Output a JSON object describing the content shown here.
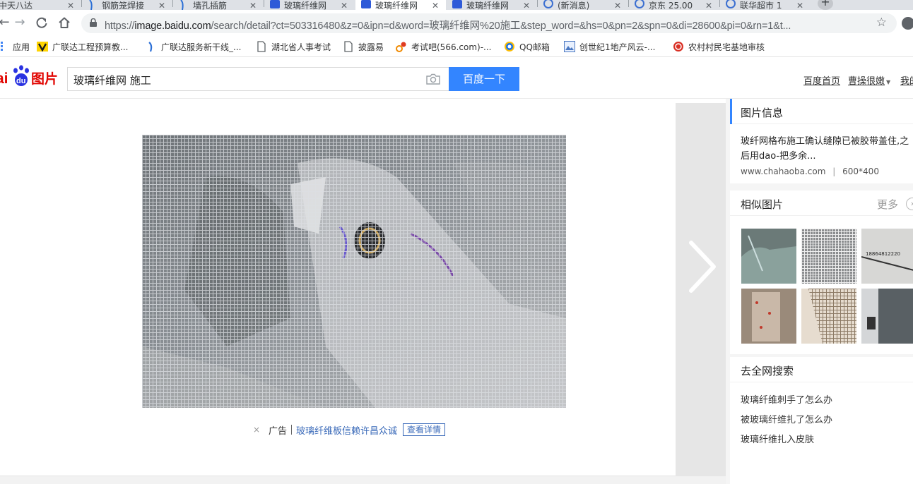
{
  "browser": {
    "tabs": [
      {
        "title": "中天八达",
        "favicon": "web-icon"
      },
      {
        "title": "钢筋笼焊接",
        "favicon": "paw-icon"
      },
      {
        "title": "墙孔插筋",
        "favicon": "paw-icon"
      },
      {
        "title": "玻璃纤维网",
        "favicon": "baidu-du-icon"
      },
      {
        "title": "玻璃纤维网",
        "favicon": "baidu-du-icon",
        "active": true
      },
      {
        "title": "玻璃纤维网",
        "favicon": "baidu-du-icon"
      },
      {
        "title": "(新消息)",
        "favicon": "globe-icon"
      },
      {
        "title": "京东 25.00",
        "favicon": "globe-icon"
      },
      {
        "title": "联华超市 1",
        "favicon": "globe-icon"
      }
    ],
    "new_tab": "+",
    "url": {
      "host_prefix": "https://",
      "host": "image.baidu.com",
      "path": "/search/detail?ct=503316480&z=0&ipn=d&word=玻璃纤维网%20施工&step_word=&hs=0&pn=2&spn=0&di=28600&pi=0&rn=1&t..."
    },
    "bookmarks": [
      {
        "label": "应用",
        "icon": "apps-grid-icon"
      },
      {
        "label": "广联达工程预算教...",
        "icon": "bookmark-favicon-icon"
      },
      {
        "label": "广联达服务新干线_...",
        "icon": "paw-icon"
      },
      {
        "label": "湖北省人事考试",
        "icon": "page-icon"
      },
      {
        "label": "披露易",
        "icon": "page-icon"
      },
      {
        "label": "考试吧(566.com)-...",
        "icon": "kaoshi-icon"
      },
      {
        "label": "QQ邮箱",
        "icon": "qq-mail-icon"
      },
      {
        "label": "创世纪1地产风云-...",
        "icon": "image-favicon-icon"
      },
      {
        "label": "农村村民宅基地审核",
        "icon": "red-seal-icon"
      }
    ]
  },
  "baidu": {
    "logo_text": "Baidu",
    "logo_cn": "图片",
    "search_query": "玻璃纤维网 施工",
    "search_button": "百度一下",
    "top_links": [
      "百度首页",
      "曹操很嫩",
      "我的"
    ],
    "main_image_alt": "玻璃纤维网格布施工",
    "ad": {
      "close": "×",
      "label": "广告",
      "link": "玻璃纤维板信赖许昌众诚",
      "detail": "查看详情"
    }
  },
  "panel": {
    "info_heading": "图片信息",
    "info_title": "玻纤网格布施工确认缝隙已被胶带盖住,之后用dao-把多余...",
    "info_source_domain": "www.chahaoba.com",
    "info_source_sep": "|",
    "info_size": "600*400",
    "similar_heading": "相似图片",
    "similar_more": "更多",
    "similar_more_arrow": "›",
    "search_heading": "去全网搜索",
    "search_queries": [
      "玻璃纤维刺手了怎么办",
      "被玻璃纤维扎了怎么办",
      "玻璃纤维扎入皮肤"
    ]
  },
  "colors": {
    "baidu_blue": "#3385ff",
    "baidu_red": "#e10602",
    "link_blue": "#3a6ab9"
  }
}
